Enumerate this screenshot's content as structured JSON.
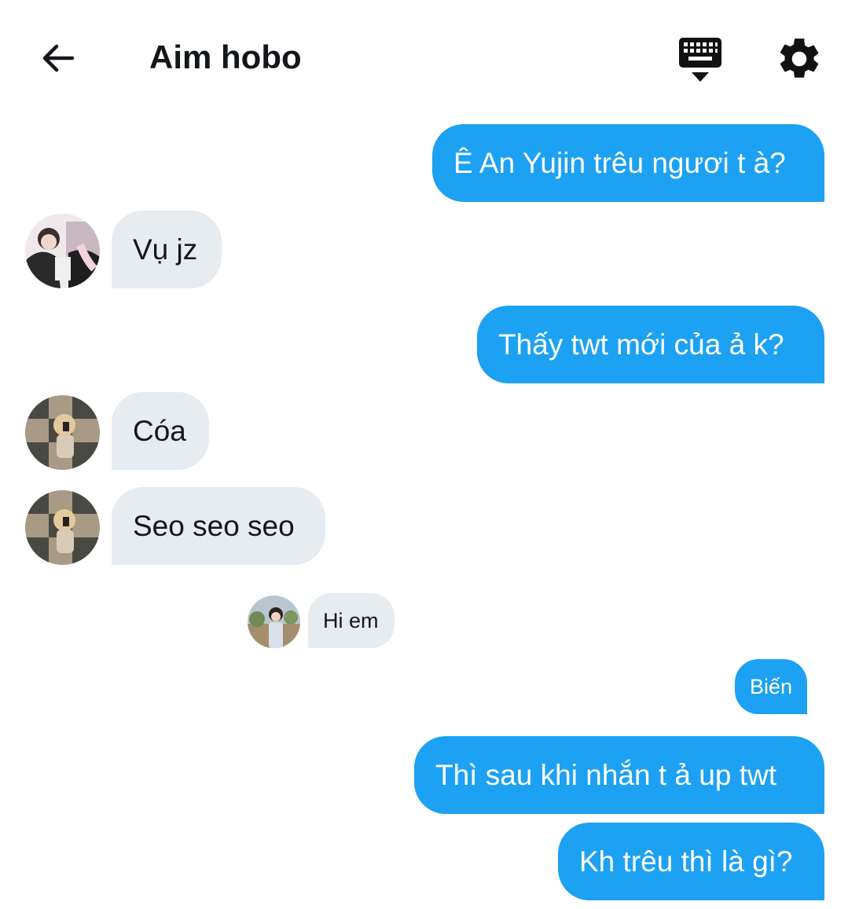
{
  "header": {
    "title": "Aim hobo",
    "back_icon": "arrow-left-icon",
    "keyboard_icon": "keyboard-hide-icon",
    "settings_icon": "gear-icon"
  },
  "colors": {
    "outgoing_bubble": "#1da1f2",
    "incoming_bubble": "#e6ecf0",
    "text": "#14171a"
  },
  "messages": [
    {
      "direction": "outgoing",
      "text": "Ê An Yujin trêu ngươi t à?"
    },
    {
      "direction": "incoming",
      "text": "Vụ jz"
    },
    {
      "direction": "outgoing",
      "text": "Thấy twt mới của ả k?"
    },
    {
      "direction": "incoming",
      "text": "Cóa"
    },
    {
      "direction": "incoming",
      "text": "Seo seo seo"
    },
    {
      "direction": "incoming",
      "text": "Hi em"
    },
    {
      "direction": "outgoing",
      "text": "Biến"
    },
    {
      "direction": "outgoing",
      "text": "Thì sau khi nhắn t ả up twt"
    },
    {
      "direction": "outgoing",
      "text": "Kh trêu thì là gì?"
    }
  ]
}
